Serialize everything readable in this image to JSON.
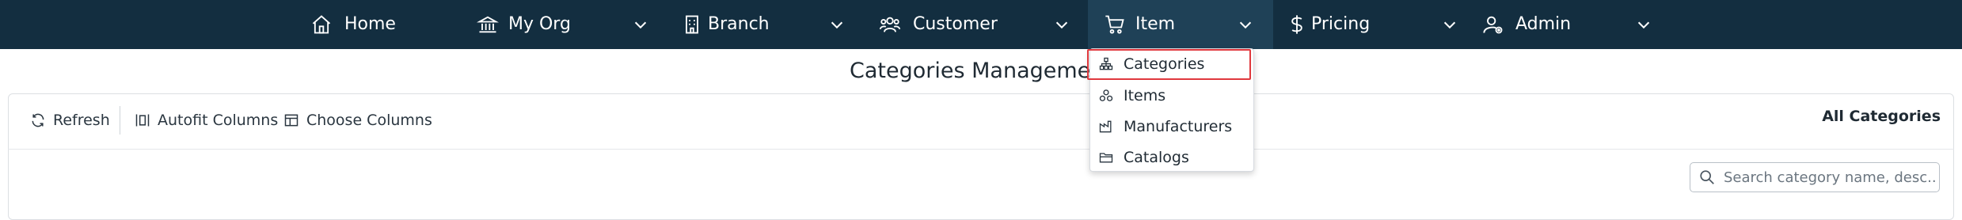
{
  "nav": {
    "home": "Home",
    "my_org": "My Org",
    "branch": "Branch",
    "customer": "Customer",
    "item": "Item",
    "pricing": "Pricing",
    "admin": "Admin"
  },
  "page": {
    "title": "Categories Management"
  },
  "toolbar": {
    "refresh": "Refresh",
    "autofit": "Autofit Columns",
    "choose_columns": "Choose Columns",
    "filter_label": "All Categories"
  },
  "search": {
    "placeholder": "Search category name, desc..."
  },
  "item_menu": {
    "items": [
      {
        "label": "Categories",
        "icon": "categories-icon",
        "highlighted": true
      },
      {
        "label": "Items",
        "icon": "items-icon"
      },
      {
        "label": "Manufacturers",
        "icon": "factory-icon"
      },
      {
        "label": "Catalogs",
        "icon": "folder-icon"
      }
    ]
  },
  "colors": {
    "navbar_bg": "#132e40",
    "active_bg": "#1f4157",
    "highlight_border": "#e0393e"
  }
}
